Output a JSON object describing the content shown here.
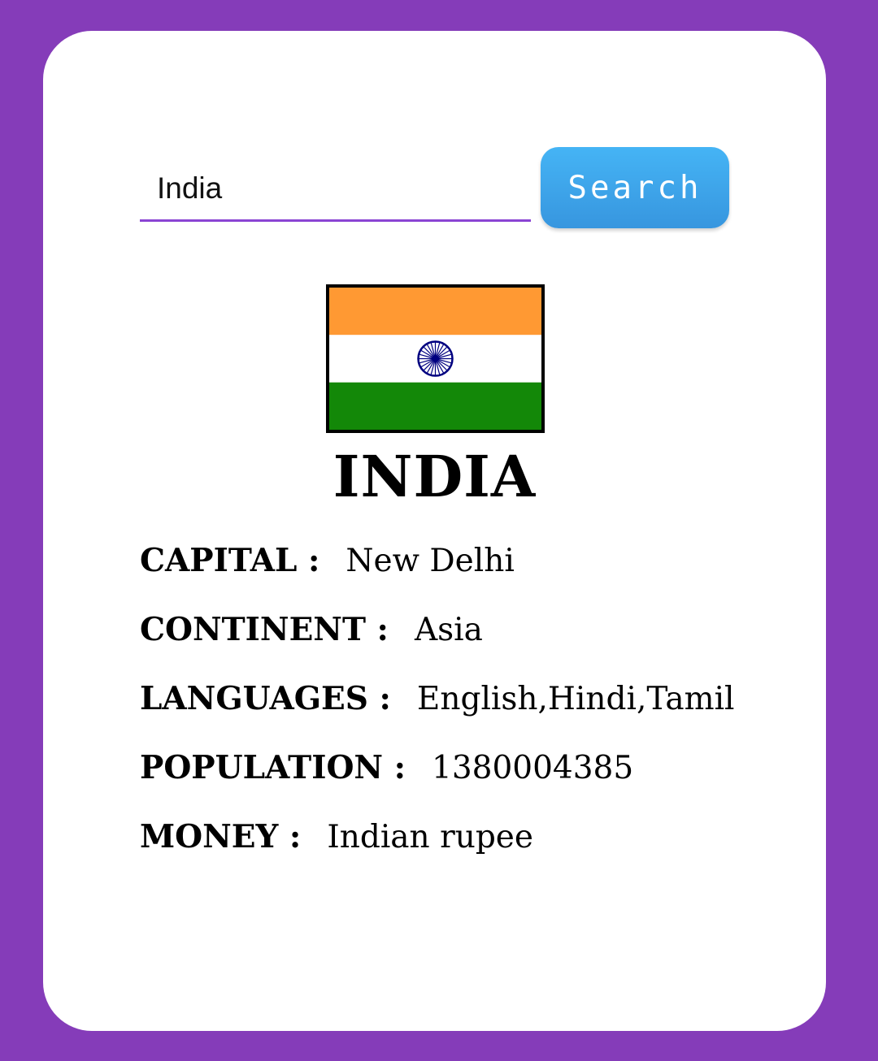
{
  "search": {
    "value": "India",
    "button_label": "Search"
  },
  "country": {
    "name": "INDIA",
    "flag": {
      "icon": "india-flag-icon",
      "colors": {
        "saffron": "#ff9933",
        "white": "#ffffff",
        "green": "#138808",
        "chakra": "#000080"
      }
    }
  },
  "info": [
    {
      "label": "CAPITAL :",
      "value": "New Delhi"
    },
    {
      "label": "CONTINENT :",
      "value": "Asia"
    },
    {
      "label": "LANGUAGES :",
      "value": "English,Hindi,Tamil"
    },
    {
      "label": "POPULATION :",
      "value": "1380004385"
    },
    {
      "label": "MONEY :",
      "value": "Indian rupee"
    }
  ],
  "colors": {
    "background": "#853cb9",
    "card": "#ffffff",
    "accent_underline": "#8a44d3",
    "button": "#3fa9ef"
  }
}
